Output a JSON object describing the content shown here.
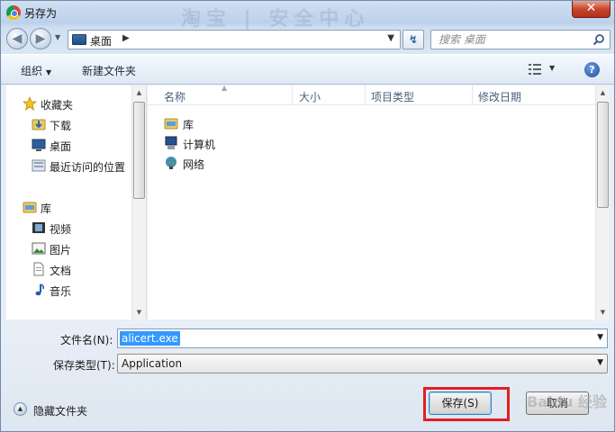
{
  "window": {
    "title": "另存为",
    "background_watermark": "淘宝 | 安全中心",
    "close_symbol": "✕"
  },
  "nav": {
    "back_symbol": "◀",
    "forward_symbol": "▶",
    "address": "桌面",
    "address_separator": "▶",
    "refresh_symbol": "↯",
    "search_placeholder": "搜索 桌面"
  },
  "toolbar": {
    "organize_label": "组织",
    "new_folder_label": "新建文件夹",
    "help_symbol": "?"
  },
  "sidebar": {
    "favorites": {
      "label": "收藏夹",
      "items": [
        {
          "label": "下载",
          "icon": "download-folder-icon"
        },
        {
          "label": "桌面",
          "icon": "desktop-icon"
        },
        {
          "label": "最近访问的位置",
          "icon": "recent-places-icon"
        }
      ]
    },
    "libraries": {
      "label": "库",
      "items": [
        {
          "label": "视频",
          "icon": "video-library-icon"
        },
        {
          "label": "图片",
          "icon": "picture-library-icon"
        },
        {
          "label": "文档",
          "icon": "document-library-icon"
        },
        {
          "label": "音乐",
          "icon": "music-library-icon"
        }
      ]
    }
  },
  "file_list": {
    "columns": [
      "名称",
      "大小",
      "项目类型",
      "修改日期"
    ],
    "items": [
      {
        "name": "库",
        "icon": "library-icon"
      },
      {
        "name": "计算机",
        "icon": "computer-icon"
      },
      {
        "name": "网络",
        "icon": "network-icon"
      }
    ]
  },
  "form": {
    "filename_label": "文件名(N):",
    "filename_value": "alicert.exe",
    "filetype_label": "保存类型(T):",
    "filetype_value": "Application",
    "hide_folders_label": "隐藏文件夹",
    "save_label": "保存(S)",
    "cancel_label": "取消",
    "watermark_text": "Baidu 经验"
  },
  "colors": {
    "highlight_box": "#e02020",
    "selection": "#3399ff"
  }
}
